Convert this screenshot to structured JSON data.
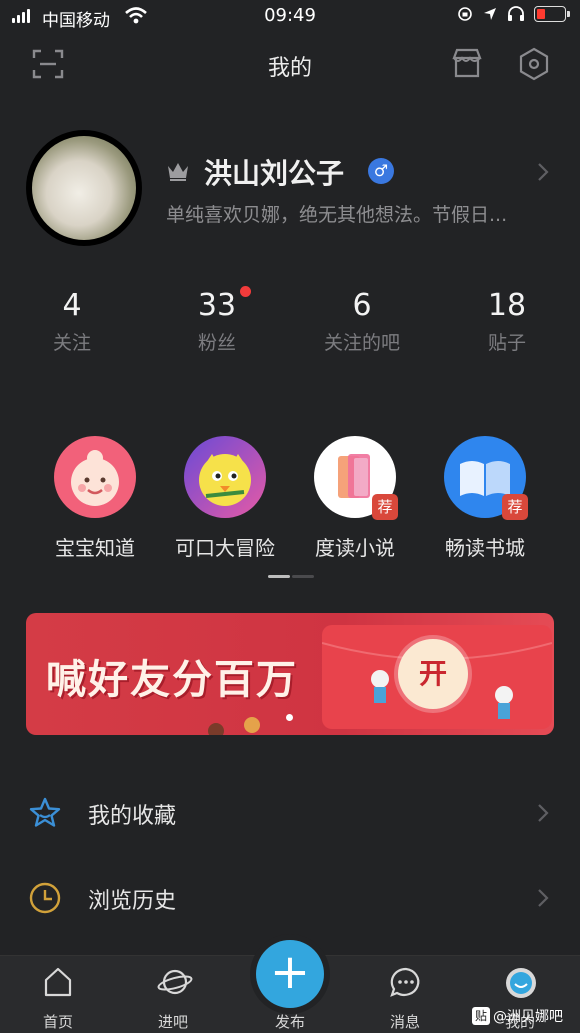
{
  "status_bar": {
    "carrier": "中国移动",
    "time": "09:49"
  },
  "header": {
    "title": "我的"
  },
  "profile": {
    "username": "洪山刘公子",
    "gender_symbol": "♂",
    "bio": "单纯喜欢贝娜，绝无其他想法。节假日..."
  },
  "stats": [
    {
      "value": "4",
      "label": "关注"
    },
    {
      "value": "33",
      "label": "粉丝"
    },
    {
      "value": "6",
      "label": "关注的吧"
    },
    {
      "value": "18",
      "label": "贴子"
    }
  ],
  "apps": [
    {
      "label": "宝宝知道",
      "icon": "baby-icon"
    },
    {
      "label": "可口大冒险",
      "icon": "game-icon"
    },
    {
      "label": "度读小说",
      "icon": "book-icon",
      "badge": "荐"
    },
    {
      "label": "畅读书城",
      "icon": "open-book-icon",
      "badge": "荐"
    }
  ],
  "banner": {
    "text": "喊好友分百万",
    "button": "开"
  },
  "menu": [
    {
      "label": "我的收藏",
      "icon": "star-icon"
    },
    {
      "label": "浏览历史",
      "icon": "clock-icon"
    }
  ],
  "tabs": [
    {
      "label": "首页",
      "icon": "home-icon"
    },
    {
      "label": "进吧",
      "icon": "planet-icon"
    },
    {
      "label": "发布",
      "icon": "plus-icon"
    },
    {
      "label": "消息",
      "icon": "message-icon"
    },
    {
      "label": "我的",
      "icon": "profile-icon"
    }
  ],
  "watermark": {
    "badge": "贴",
    "text": "@洲贝娜吧"
  },
  "colors": {
    "background": "#222325",
    "accent_blue": "#33a6de",
    "banner_red": "#d43c46",
    "notification_red": "#f23b3b"
  }
}
